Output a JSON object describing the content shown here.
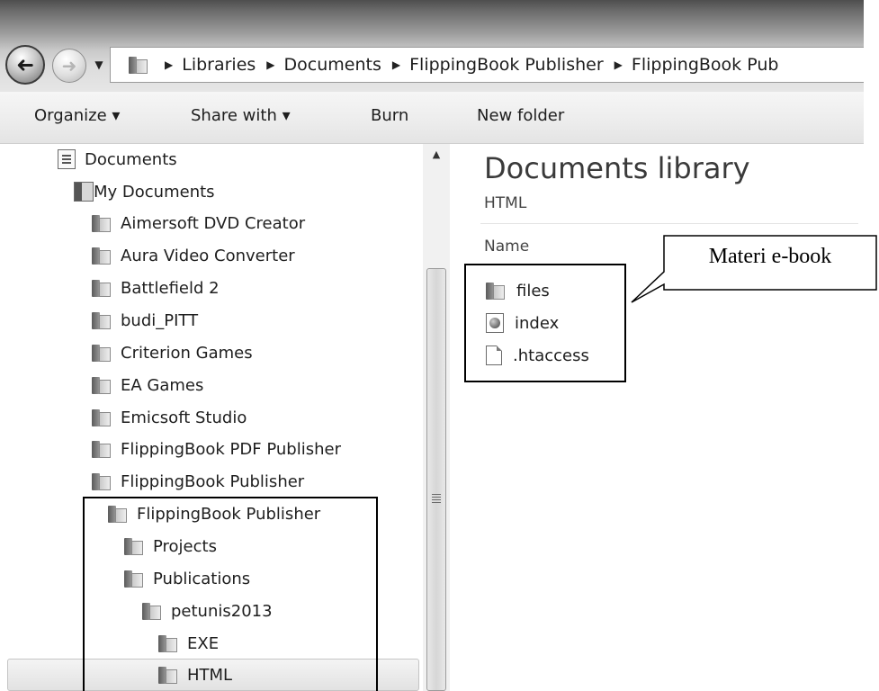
{
  "navigation": {
    "back_label": "Back",
    "forward_label": "Forward"
  },
  "address_bar": {
    "breadcrumbs": [
      "Libraries",
      "Documents",
      "FlippingBook Publisher",
      "FlippingBook Pub"
    ]
  },
  "toolbar": {
    "organize": "Organize ▾",
    "share_with": "Share with ▾",
    "burn": "Burn",
    "new_folder": "New folder"
  },
  "tree": {
    "items": [
      {
        "label": "Documents",
        "icon": "document-library-icon"
      },
      {
        "label": "My Documents",
        "icon": "my-documents-icon"
      },
      {
        "label": "Aimersoft DVD Creator",
        "icon": "folder-icon"
      },
      {
        "label": "Aura Video Converter",
        "icon": "folder-icon"
      },
      {
        "label": "Battlefield 2",
        "icon": "folder-icon"
      },
      {
        "label": "budi_PITT",
        "icon": "folder-icon"
      },
      {
        "label": "Criterion Games",
        "icon": "folder-icon"
      },
      {
        "label": "EA Games",
        "icon": "folder-icon"
      },
      {
        "label": "Emicsoft Studio",
        "icon": "folder-icon"
      },
      {
        "label": "FlippingBook PDF Publisher",
        "icon": "folder-icon"
      },
      {
        "label": "FlippingBook Publisher",
        "icon": "folder-icon"
      },
      {
        "label": "FlippingBook Publisher",
        "icon": "folder-icon"
      },
      {
        "label": "Projects",
        "icon": "folder-icon"
      },
      {
        "label": "Publications",
        "icon": "folder-icon"
      },
      {
        "label": "petunis2013",
        "icon": "folder-icon"
      },
      {
        "label": "EXE",
        "icon": "folder-icon"
      },
      {
        "label": "HTML",
        "icon": "folder-icon"
      }
    ],
    "selected": "HTML"
  },
  "content": {
    "title": "Documents library",
    "subtitle": "HTML",
    "column_name": "Name",
    "files": [
      {
        "name": "files",
        "icon": "folder-icon"
      },
      {
        "name": "index",
        "icon": "html-file-icon"
      },
      {
        "name": ".htaccess",
        "icon": "blank-file-icon"
      }
    ]
  },
  "annotation": {
    "callout_text": "Materi e-book"
  },
  "colors": {
    "selection": "#e2e2e2",
    "annotation_border": "#000000"
  }
}
